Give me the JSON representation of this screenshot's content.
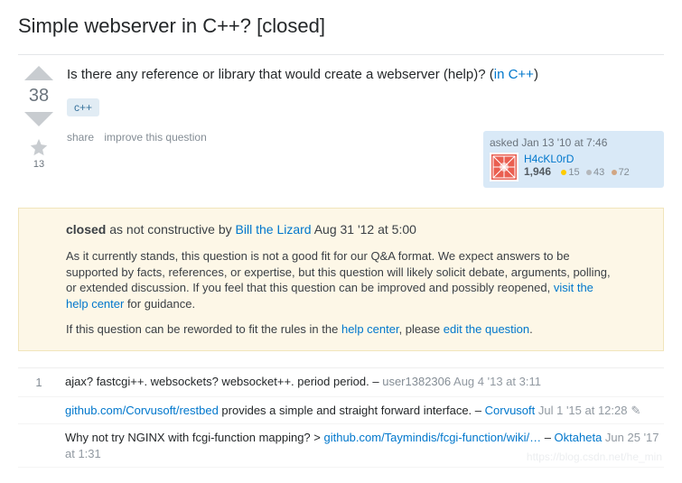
{
  "title": "Simple webserver in C++? [closed]",
  "question": {
    "body_pre": "Is there any reference or library that would create a webserver (help)? (",
    "body_link": "in C++",
    "body_post": ")",
    "tag": "c++",
    "score": "38",
    "favorites": "13",
    "actions": {
      "share": "share",
      "improve": "improve this question"
    },
    "usercard": {
      "when": "asked Jan 13 '10 at 7:46",
      "name": "H4cKL0rD",
      "rep": "1,946",
      "gold": "15",
      "silver": "43",
      "bronze": "72"
    }
  },
  "notice": {
    "closed_strong": "closed",
    "closed_mid": " as not constructive by ",
    "closer": "Bill the Lizard",
    "closed_time": " Aug 31 '12 at 5:00",
    "para1_pre": "As it currently stands, this question is not a good fit for our Q&A format. We expect answers to be supported by facts, references, or expertise, but this question will likely solicit debate, arguments, polling, or extended discussion. If you feel that this question can be improved and possibly reopened, ",
    "para1_link": "visit the help center",
    "para1_post": " for guidance.",
    "para2_pre": "If this question can be reworded to fit the rules in the ",
    "para2_link1": "help center",
    "para2_mid": ", please ",
    "para2_link2": "edit the question",
    "para2_post": "."
  },
  "comments": [
    {
      "score": "1",
      "text_pre": "ajax? fastcgi++. websockets? websocket++. period period. – ",
      "user_plain": "user1382306",
      "date": " Aug 4 '13 at 3:11"
    },
    {
      "score": "",
      "link1": "github.com/Corvusoft/restbed",
      "text_mid": " provides a simple and straight forward interface. – ",
      "user": "Corvusoft",
      "date": " Jul 1 '15 at 12:28",
      "edited": true
    },
    {
      "score": "",
      "text_pre": "Why not try NGINX with fcgi-function mapping? > ",
      "link1": "github.com/Taymindis/fcgi-function/wiki/…",
      "text_mid": " – ",
      "user": "Oktaheta",
      "date": " Jun 25 '17 at 1:31"
    }
  ],
  "watermark": "https://blog.csdn.net/he_min"
}
